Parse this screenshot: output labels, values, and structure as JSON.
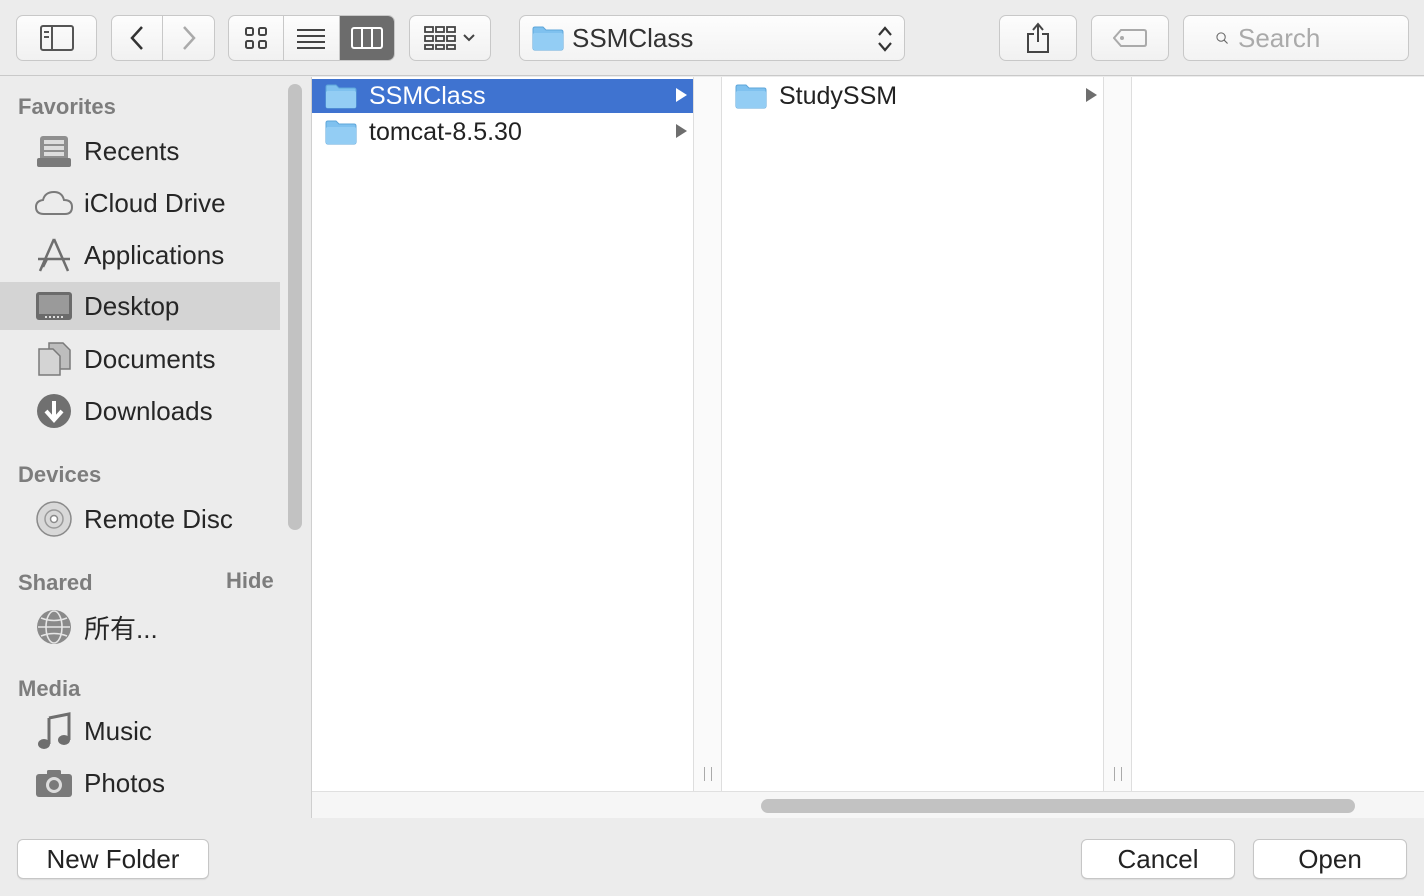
{
  "toolbar": {
    "path_popup_label": "SSMClass",
    "search_placeholder": "Search",
    "view_mode": "columns"
  },
  "sidebar": {
    "favorites_label": "Favorites",
    "favorites": [
      {
        "label": "Recents",
        "icon": "recents-icon"
      },
      {
        "label": "iCloud Drive",
        "icon": "cloud-icon"
      },
      {
        "label": "Applications",
        "icon": "applications-icon"
      },
      {
        "label": "Desktop",
        "icon": "desktop-icon",
        "selected": true
      },
      {
        "label": "Documents",
        "icon": "documents-icon"
      },
      {
        "label": "Downloads",
        "icon": "downloads-icon"
      }
    ],
    "devices_label": "Devices",
    "devices": [
      {
        "label": "Remote Disc",
        "icon": "disc-icon"
      }
    ],
    "shared_label": "Shared",
    "shared_hide": "Hide",
    "shared": [
      {
        "label": "所有...",
        "icon": "network-globe-icon"
      }
    ],
    "media_label": "Media",
    "media": [
      {
        "label": "Music",
        "icon": "music-note-icon"
      },
      {
        "label": "Photos",
        "icon": "camera-icon"
      }
    ]
  },
  "columns": [
    {
      "items": [
        {
          "label": "SSMClass",
          "selected": true
        },
        {
          "label": "tomcat-8.5.30",
          "selected": false
        }
      ]
    },
    {
      "items": [
        {
          "label": "StudySSM",
          "selected": false
        }
      ]
    },
    {
      "items": []
    }
  ],
  "buttons": {
    "new_folder": "New Folder",
    "cancel": "Cancel",
    "open": "Open"
  },
  "colors": {
    "selection": "#3f73d0",
    "folder": "#7fc1ef"
  }
}
